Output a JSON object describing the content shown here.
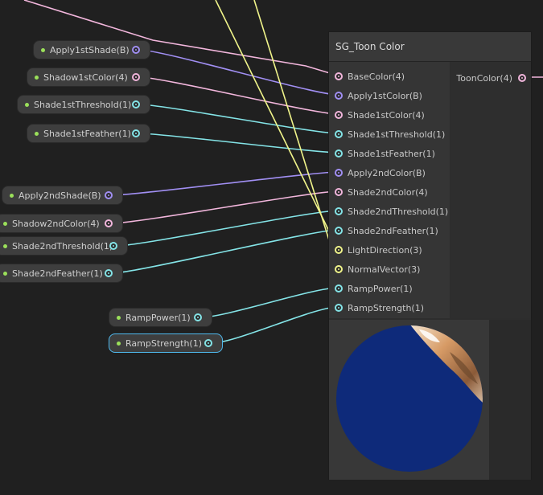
{
  "node": {
    "title": "SG_Toon Color",
    "inputs": [
      {
        "label": "BaseColor(4)",
        "type": "pink"
      },
      {
        "label": "Apply1stColor(B)",
        "type": "purple"
      },
      {
        "label": "Shade1stColor(4)",
        "type": "pink"
      },
      {
        "label": "Shade1stThreshold(1)",
        "type": "cyan"
      },
      {
        "label": "Shade1stFeather(1)",
        "type": "cyan"
      },
      {
        "label": "Apply2ndColor(B)",
        "type": "purple"
      },
      {
        "label": "Shade2ndColor(4)",
        "type": "pink"
      },
      {
        "label": "Shade2ndThreshold(1)",
        "type": "cyan"
      },
      {
        "label": "Shade2ndFeather(1)",
        "type": "cyan"
      },
      {
        "label": "LightDirection(3)",
        "type": "yellow"
      },
      {
        "label": "NormalVector(3)",
        "type": "yellow"
      },
      {
        "label": "RampPower(1)",
        "type": "cyan"
      },
      {
        "label": "RampStrength(1)",
        "type": "cyan"
      }
    ],
    "output": {
      "label": "ToonColor(4)",
      "type": "pink"
    }
  },
  "properties": [
    {
      "label": "Apply1stShade(B)",
      "type": "purple"
    },
    {
      "label": "Shadow1stColor(4)",
      "type": "pink"
    },
    {
      "label": "Shade1stThreshold(1)",
      "type": "cyan"
    },
    {
      "label": "Shade1stFeather(1)",
      "type": "cyan"
    },
    {
      "label": "Apply2ndShade(B)",
      "type": "purple"
    },
    {
      "label": "Shadow2ndColor(4)",
      "type": "pink"
    },
    {
      "label": "Shade2ndThreshold(1)",
      "type": "cyan"
    },
    {
      "label": "Shade2ndFeather(1)",
      "type": "cyan"
    },
    {
      "label": "RampPower(1)",
      "type": "cyan"
    },
    {
      "label": "RampStrength(1)",
      "type": "cyan",
      "selected": true
    }
  ],
  "colors": {
    "pink": "#f2b6dc",
    "purple": "#a18ff3",
    "cyan": "#84e4e7",
    "yellow": "#f0f48a",
    "sphere": "#0e2a7a"
  }
}
